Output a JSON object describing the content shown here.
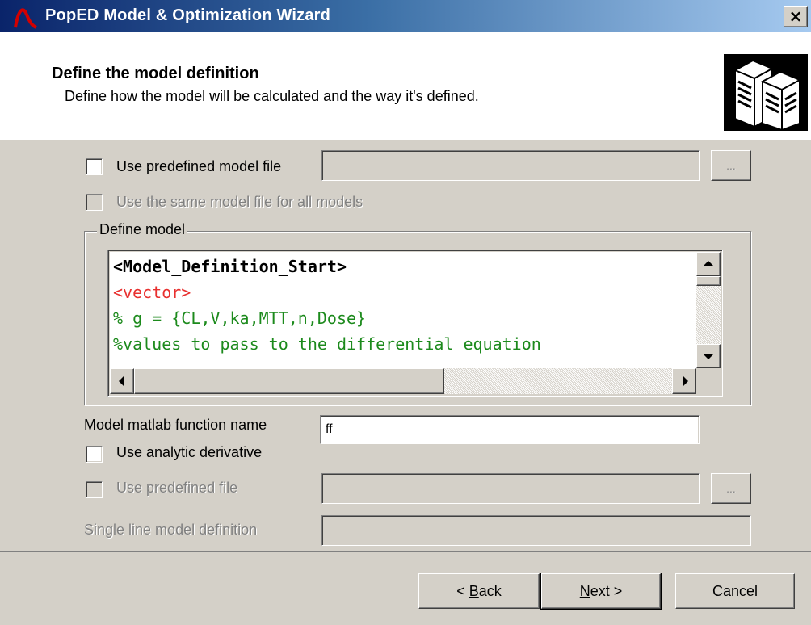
{
  "window": {
    "title": "PopED Model & Optimization Wizard",
    "close_glyph": "×",
    "icon": "poped-curve-icon"
  },
  "header": {
    "title": "Define the model definition",
    "subtitle": "Define how the model will be calculated and the way it's defined.",
    "image": "servers-icon"
  },
  "form": {
    "use_predefined_model_file": {
      "label": "Use predefined model file",
      "checked": false,
      "value": "",
      "browse_label": "..."
    },
    "same_model_file": {
      "label": "Use the same model file for all models",
      "checked": false,
      "disabled": true
    },
    "define_model": {
      "group_label": "Define model",
      "code_lines": [
        {
          "text": "<Model_Definition_Start>",
          "color": "#000000",
          "bold": true
        },
        {
          "text": "<vector>",
          "color": "#e8302f",
          "bold": false
        },
        {
          "text": "% g = {CL,V,ka,MTT,n,Dose}",
          "color": "#1c8a1c",
          "bold": false
        },
        {
          "text": "%values to pass to the differential equation",
          "color": "#1c8a1c",
          "bold": false
        }
      ]
    },
    "matlab_function": {
      "label": "Model matlab function name",
      "value": "ff"
    },
    "analytic_derivative": {
      "label": "Use analytic derivative",
      "checked": false
    },
    "predefined_file": {
      "label": "Use predefined file",
      "checked": false,
      "disabled": true,
      "value": "",
      "browse_label": "..."
    },
    "single_line": {
      "label": "Single line model definition",
      "value": "",
      "disabled": true
    }
  },
  "footer": {
    "back_prefix": "< ",
    "back_key": "B",
    "back_rest": "ack",
    "next_key": "N",
    "next_rest": "ext >",
    "cancel_label": "Cancel"
  }
}
